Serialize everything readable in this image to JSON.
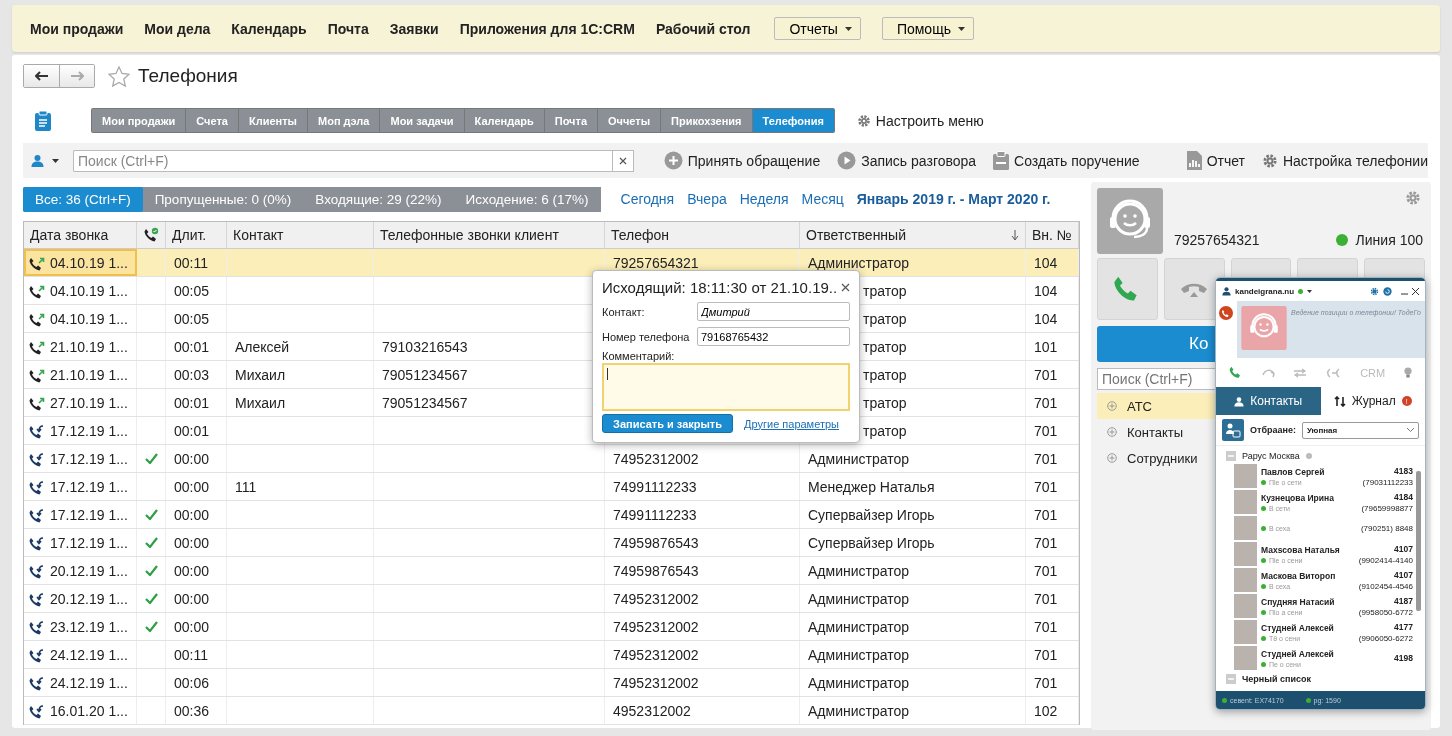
{
  "top_nav": [
    {
      "kind": "link",
      "label": "Мои продажи"
    },
    {
      "kind": "link",
      "label": "Мои дела"
    },
    {
      "kind": "link",
      "label": "Календарь"
    },
    {
      "kind": "link",
      "label": "Почта"
    },
    {
      "kind": "link",
      "label": "Заявки"
    },
    {
      "kind": "link",
      "label": "Приложения для 1С:CRM"
    },
    {
      "kind": "link",
      "label": "Рабочий стол"
    },
    {
      "kind": "dropdown",
      "label": "Отчеты"
    },
    {
      "kind": "dropdown",
      "label": "Помощь"
    }
  ],
  "page": {
    "title": "Телефония"
  },
  "section_tabs": [
    {
      "label": "Мои продажи",
      "selected": false
    },
    {
      "label": "Счета",
      "selected": false
    },
    {
      "label": "Клиенты",
      "selected": false
    },
    {
      "label": "Моп дэла",
      "selected": false
    },
    {
      "label": "Мои задачи",
      "selected": false
    },
    {
      "label": "Календарь",
      "selected": false
    },
    {
      "label": "Почта",
      "selected": false
    },
    {
      "label": "Оччеты",
      "selected": false
    },
    {
      "label": "Прикохзения",
      "selected": false
    },
    {
      "label": "Телефония",
      "selected": true
    }
  ],
  "customize_menu": "Настроить меню",
  "search": {
    "placeholder": "Поиск (Ctrl+F)"
  },
  "actions": [
    {
      "kind": "accept",
      "label": "Принять обращение"
    },
    {
      "kind": "record",
      "label": "Запись разговора"
    },
    {
      "kind": "task",
      "label": "Создать поручение"
    },
    {
      "kind": "report",
      "label": "Отчет"
    },
    {
      "kind": "settings",
      "label": "Настройка телефонии"
    }
  ],
  "filters": [
    {
      "label": "Все: 36 (Ctrl+F)",
      "selected": true
    },
    {
      "label": "Пропущенные: 0 (0%)",
      "selected": false
    },
    {
      "label": "Входящие: 29 (22%)",
      "selected": false
    },
    {
      "label": "Исходение: 6 (17%)",
      "selected": false
    }
  ],
  "periods": [
    {
      "label": "Сегодня",
      "selected": false
    },
    {
      "label": "Вчера",
      "selected": false
    },
    {
      "label": "Неделя",
      "selected": false
    },
    {
      "label": "Месяц",
      "selected": false
    },
    {
      "label": "Январь 2019 г. - Март 2020 г.",
      "selected": true
    }
  ],
  "table": {
    "columns": [
      {
        "kind": "text",
        "label": "Дата звонка"
      },
      {
        "kind": "icon"
      },
      {
        "kind": "text",
        "label": "Длит."
      },
      {
        "kind": "text",
        "label": "Контакт"
      },
      {
        "kind": "text",
        "label": "Телефонные звонки клиент"
      },
      {
        "kind": "text",
        "label": "Телефон"
      },
      {
        "kind": "text",
        "label": "Ответственный",
        "sorted": true
      },
      {
        "kind": "text",
        "label": "Вн. №"
      }
    ],
    "rows": [
      {
        "kind": "outgoing",
        "date": "04.10.19 1...",
        "checked": false,
        "duration": "00:11",
        "phone": "79257654321",
        "responsible": "Администратор",
        "ext": "104",
        "selected": true,
        "under_popup": false
      },
      {
        "kind": "outgoing",
        "date": "04.10.19 1...",
        "checked": false,
        "duration": "00:05",
        "responsible": "тратор",
        "ext": "104",
        "selected": false,
        "under_popup": true
      },
      {
        "kind": "outgoing",
        "date": "04.10.19 1...",
        "checked": false,
        "duration": "00:05",
        "responsible": "тратор",
        "ext": "104",
        "selected": false,
        "under_popup": true
      },
      {
        "kind": "outgoing",
        "date": "21.10.19 1...",
        "checked": false,
        "duration": "00:01",
        "contact": "Алексей",
        "client_phone": "79103216543",
        "responsible": "тратор",
        "ext": "101",
        "selected": false,
        "under_popup": true
      },
      {
        "kind": "outgoing",
        "date": "21.10.19 1...",
        "checked": false,
        "duration": "00:03",
        "contact": "Михаил",
        "client_phone": "79051234567",
        "responsible": "тратор",
        "ext": "701",
        "selected": false,
        "under_popup": true
      },
      {
        "kind": "outgoing",
        "date": "27.10.19 1...",
        "checked": false,
        "duration": "00:01",
        "contact": "Михаил",
        "client_phone": "79051234567",
        "responsible": "тратор",
        "ext": "701",
        "selected": false,
        "under_popup": true
      },
      {
        "kind": "incoming",
        "date": "17.12.19 1...",
        "checked": false,
        "duration": "00:01",
        "responsible": "тратор",
        "ext": "701",
        "selected": false,
        "under_popup": true
      },
      {
        "kind": "incoming",
        "date": "17.12.19 1...",
        "checked": true,
        "duration": "00:00",
        "phone": "74952312002",
        "responsible": "Администратор",
        "ext": "701",
        "selected": false,
        "under_popup": false
      },
      {
        "kind": "incoming",
        "date": "17.12.19 1...",
        "checked": false,
        "duration": "00:00",
        "contact": "111",
        "phone": "74991112233",
        "responsible": "Менеджер Наталья",
        "ext": "701",
        "selected": false,
        "under_popup": false
      },
      {
        "kind": "incoming",
        "date": "17.12.19 1...",
        "checked": true,
        "duration": "00:00",
        "phone": "74991112233",
        "responsible": "Супервайзер Игорь",
        "ext": "701",
        "selected": false,
        "under_popup": false
      },
      {
        "kind": "incoming",
        "date": "17.12.19 1...",
        "checked": true,
        "duration": "00:00",
        "phone": "74959876543",
        "responsible": "Супервайзер Игорь",
        "ext": "701",
        "selected": false,
        "under_popup": false
      },
      {
        "kind": "incoming",
        "date": "20.12.19 1...",
        "checked": true,
        "duration": "00:00",
        "phone": "74959876543",
        "responsible": "Администратор",
        "ext": "701",
        "selected": false,
        "under_popup": false
      },
      {
        "kind": "incoming",
        "date": "20.12.19 1...",
        "checked": true,
        "duration": "00:00",
        "phone": "74952312002",
        "responsible": "Администратор",
        "ext": "701",
        "selected": false,
        "under_popup": false
      },
      {
        "kind": "incoming",
        "date": "23.12.19 1...",
        "checked": true,
        "duration": "00:00",
        "phone": "74952312002",
        "responsible": "Администратор",
        "ext": "701",
        "selected": false,
        "under_popup": false
      },
      {
        "kind": "incoming",
        "date": "24.12.19 1...",
        "checked": false,
        "duration": "00:11",
        "phone": "74952312002",
        "responsible": "Администратор",
        "ext": "701",
        "selected": false,
        "under_popup": false
      },
      {
        "kind": "incoming",
        "date": "24.12.19 1...",
        "checked": false,
        "duration": "00:06",
        "phone": "74952312002",
        "responsible": "Администратор",
        "ext": "701",
        "selected": false,
        "under_popup": false
      },
      {
        "kind": "incoming",
        "date": "16.01.20 1...",
        "checked": false,
        "duration": "00:36",
        "phone": "4952312002",
        "responsible": "Администратор",
        "ext": "102",
        "selected": false,
        "under_popup": false
      }
    ]
  },
  "popup": {
    "title": "Исходящий: 18:11:30 от 21.10.19..",
    "fields": [
      {
        "label": "Контакт:",
        "value": "Дмитрий"
      },
      {
        "label": "Номер телефона",
        "value": "79168765432"
      }
    ],
    "comment_label": "Комментарий:",
    "save_button": "Записать и закрыть",
    "more_link": "Другие параметры"
  },
  "phone_panel": {
    "number": "79257654321",
    "line": "Линия 100",
    "main_button": "Ко",
    "search": {
      "placeholder": "Поиск (Ctrl+F)"
    },
    "tree": [
      {
        "label": "АТС",
        "selected": true
      },
      {
        "label": "Контакты",
        "selected": false
      },
      {
        "label": "Сотрудники",
        "selected": false
      }
    ]
  },
  "widget": {
    "account": "kandeigrana.nu",
    "notice": "Ведение позиции о телефонии! ТодеГо",
    "crm": "CRM",
    "tabs": [
      {
        "kind": "contacts",
        "label": "Контакты",
        "selected": true
      },
      {
        "kind": "journal",
        "label": "Журнал",
        "badge": "!",
        "selected": false
      }
    ],
    "filter_label": "Отбраане:",
    "filter_value": "Уюпная",
    "group": "Рарус Москва",
    "contacts": [
      {
        "name": "Павлов Сергей",
        "status": "Пle о сети",
        "ext": "4183",
        "phone": "(79031112233"
      },
      {
        "name": "Кузнецова Ирина",
        "status": "В сети",
        "ext": "4184",
        "phone": "(79659998877"
      },
      {
        "status": "В сеха",
        "phone": "(790251) 8848"
      },
      {
        "name": "Маxsсова Наталья",
        "status": "Пle о сени",
        "ext": "4107",
        "phone": "(9902414-4140"
      },
      {
        "name": "Маскова Витороп",
        "status": "В сеха",
        "ext": "4107",
        "phone": "(9102454-4546"
      },
      {
        "name": "Спудняя Натасий",
        "status": "Пlo а сени",
        "ext": "4187",
        "phone": "(9958050-6772"
      },
      {
        "name": "Студней Алексей",
        "status": "Тθ о сени",
        "ext": "4177",
        "phone": "(9906050-6272"
      },
      {
        "name": "Студней Алексей",
        "status": "Пe о сени",
        "ext": "4198"
      }
    ],
    "blacklist": "Черный список",
    "footer": [
      "севent: EX74170",
      "pg: 1590"
    ]
  }
}
